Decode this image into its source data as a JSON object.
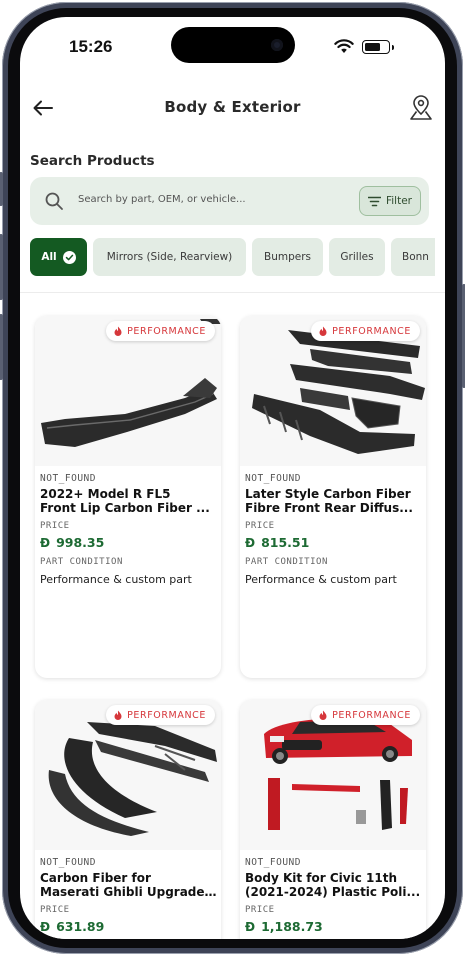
{
  "status_bar": {
    "time": "15:26"
  },
  "header": {
    "title": "Body & Exterior"
  },
  "search": {
    "section_label": "Search Products",
    "placeholder": "Search by part, OEM, or vehicle...",
    "filter_label": "Filter"
  },
  "categories": [
    "All",
    "Mirrors (Side, Rearview)",
    "Bumpers",
    "Grilles",
    "Bonn"
  ],
  "badge_label": "PERFORMANCE",
  "products": [
    {
      "brand": "NOT_FOUND",
      "name_line1": "2022+ Model R FL5",
      "name_line2": "Front Lip Carbon Fiber ...",
      "price_label": "PRICE",
      "currency": "Đ",
      "price": "998.35",
      "condition_label": "PART CONDITION",
      "condition": "Performance & custom part"
    },
    {
      "brand": "NOT_FOUND",
      "name_line1": "Later Style Carbon Fiber",
      "name_line2": "Fibre Front Rear Diffus...",
      "price_label": "PRICE",
      "currency": "Đ",
      "price": "815.51",
      "condition_label": "PART CONDITION",
      "condition": "Performance & custom part"
    },
    {
      "brand": "NOT_FOUND",
      "name_line1": "Carbon Fiber for",
      "name_line2": "Maserati Ghibli Upgrade...",
      "price_label": "PRICE",
      "currency": "Đ",
      "price": "631.89"
    },
    {
      "brand": "NOT_FOUND",
      "name_line1": "Body Kit for Civic 11th",
      "name_line2": "(2021-2024) Plastic Poli...",
      "price_label": "PRICE",
      "currency": "Đ",
      "price": "1,188.73"
    }
  ],
  "colors": {
    "accent": "#145a22",
    "price": "#1d6a33",
    "badge": "#d6373b",
    "search_bg": "#e7efe8"
  }
}
